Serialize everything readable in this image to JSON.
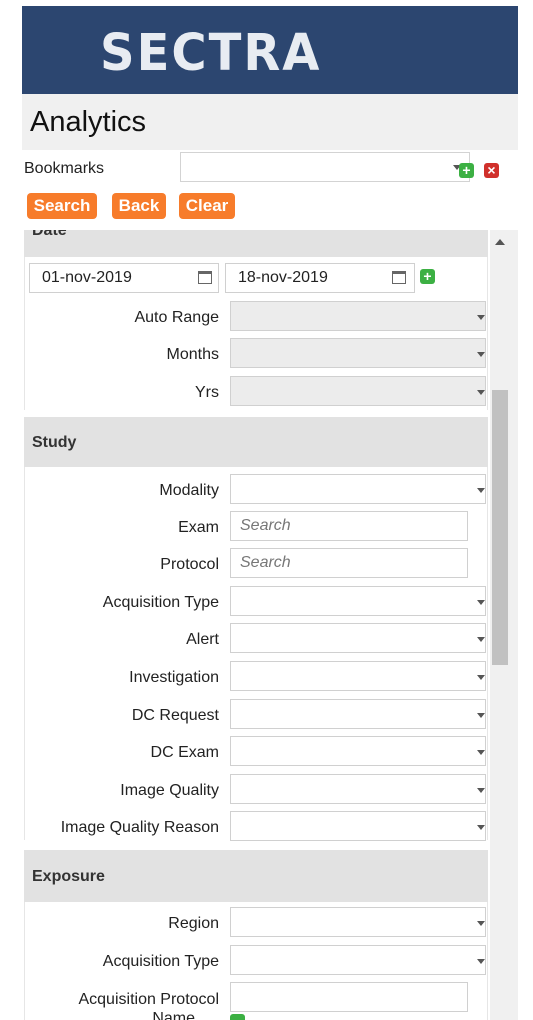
{
  "brand": {
    "logo_text": "SECTRA"
  },
  "page": {
    "title": "Analytics"
  },
  "bookmarks": {
    "label": "Bookmarks",
    "value": ""
  },
  "actions": {
    "search": "Search",
    "back": "Back",
    "clear": "Clear"
  },
  "date_section": {
    "title": "Date",
    "from": "01-nov-2019",
    "to": "18-nov-2019",
    "auto_range_label": "Auto Range",
    "months_label": "Months",
    "yrs_label": "Yrs"
  },
  "study_section": {
    "title": "Study",
    "modality_label": "Modality",
    "exam_label": "Exam",
    "exam_placeholder": "Search",
    "protocol_label": "Protocol",
    "protocol_placeholder": "Search",
    "acquisition_type_label": "Acquisition Type",
    "alert_label": "Alert",
    "investigation_label": "Investigation",
    "dc_request_label": "DC Request",
    "dc_exam_label": "DC Exam",
    "image_quality_label": "Image Quality",
    "image_quality_reason_label": "Image Quality Reason"
  },
  "exposure_section": {
    "title": "Exposure",
    "region_label": "Region",
    "acquisition_type_label": "Acquisition Type",
    "acquisition_protocol_label": "Acquisition Protocol",
    "acquisition_protocol_label_2": "Name"
  },
  "colors": {
    "header_bg": "#2c4670",
    "button_bg": "#f77c2b",
    "add": "#3cb043",
    "remove": "#d0302b"
  }
}
